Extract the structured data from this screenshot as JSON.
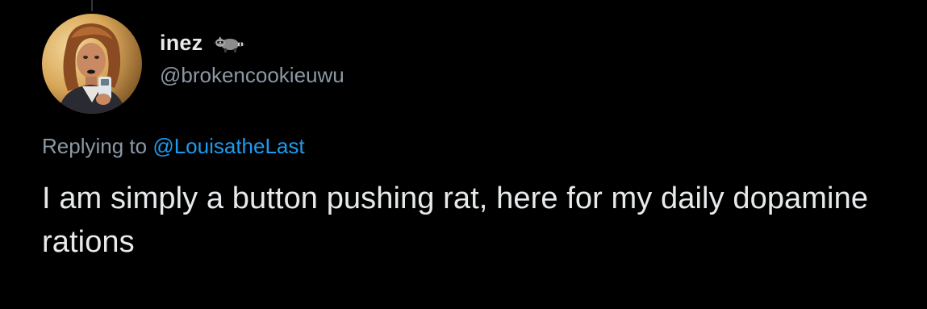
{
  "tweet": {
    "author": {
      "display_name": "inez",
      "handle": "@brokencookieuwu",
      "name_emoji_icon": "raccoon-icon",
      "avatar": "profile-photo"
    },
    "reply_prefix": "Replying to ",
    "reply_to": "@LouisatheLast",
    "text": "I am simply a button pushing rat, here for my daily dopamine rations"
  },
  "colors": {
    "background": "#000000",
    "primary_text": "#e7e9ea",
    "secondary_text": "#8b98a5",
    "link": "#1d9bf0"
  }
}
